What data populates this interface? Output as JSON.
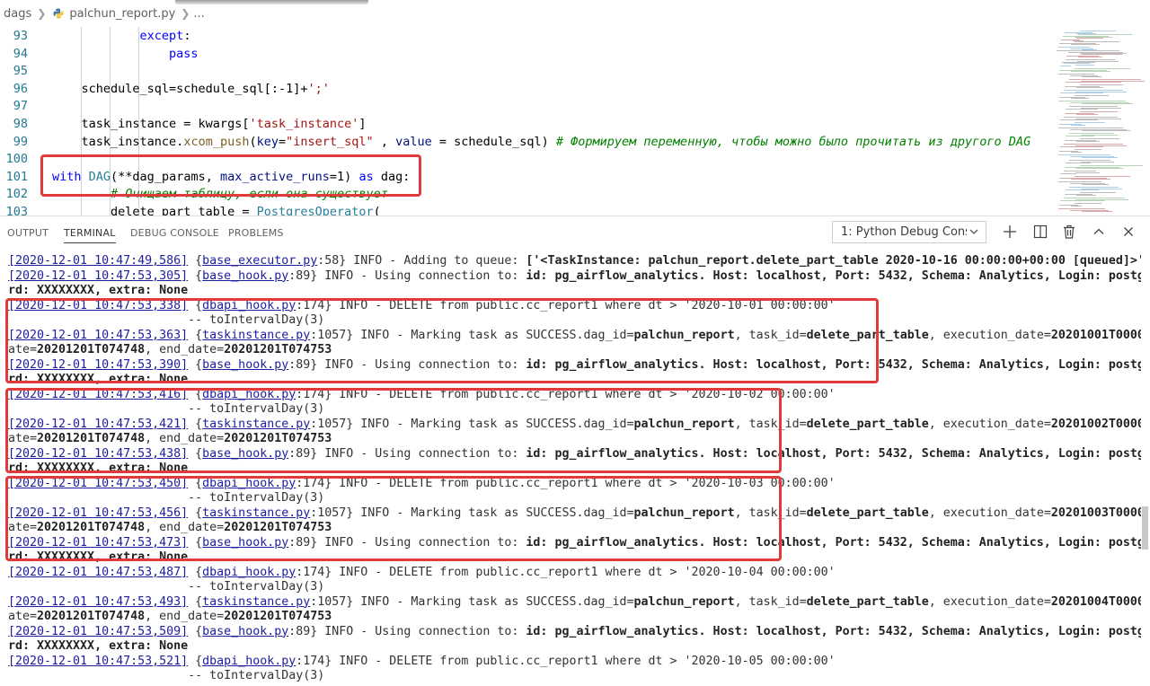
{
  "breadcrumb": {
    "folder": "dags",
    "file": "palchun_report.py",
    "more": "..."
  },
  "editor": {
    "lines": [
      {
        "n": "93",
        "tokens": [
          [
            "            ",
            "plain"
          ],
          [
            "except",
            "kw2"
          ],
          [
            ":",
            "plain"
          ]
        ]
      },
      {
        "n": "94",
        "tokens": [
          [
            "                ",
            "plain"
          ],
          [
            "pass",
            "kw2"
          ]
        ]
      },
      {
        "n": "95",
        "tokens": []
      },
      {
        "n": "96",
        "tokens": [
          [
            "    schedule_sql=schedule_sql[:-1]+",
            "plain"
          ],
          [
            "';'",
            "str"
          ]
        ]
      },
      {
        "n": "97",
        "tokens": []
      },
      {
        "n": "98",
        "tokens": [
          [
            "    task_instance = kwargs[",
            "plain"
          ],
          [
            "'task_instance'",
            "str"
          ],
          [
            "]",
            "plain"
          ]
        ]
      },
      {
        "n": "99",
        "tokens": [
          [
            "    task_instance.",
            "plain"
          ],
          [
            "xcom_push",
            "fn"
          ],
          [
            "(",
            "plain"
          ],
          [
            "key",
            "param"
          ],
          [
            "=",
            "plain"
          ],
          [
            "\"insert_sql\"",
            "str"
          ],
          [
            " , ",
            "plain"
          ],
          [
            "value",
            "param"
          ],
          [
            " = schedule_sql) ",
            "plain"
          ],
          [
            "# Формируем переменную, чтобы можно было прочитать из другого DAG",
            "cmt"
          ]
        ]
      },
      {
        "n": "100",
        "tokens": []
      },
      {
        "n": "101",
        "tokens": [
          [
            "with",
            "kw2"
          ],
          [
            " ",
            "plain"
          ],
          [
            "DAG",
            "cls"
          ],
          [
            "(**dag_params, ",
            "plain"
          ],
          [
            "max_active_runs",
            "param"
          ],
          [
            "=",
            "plain"
          ],
          [
            "1",
            "num"
          ],
          [
            ") ",
            "plain"
          ],
          [
            "as",
            "kw2"
          ],
          [
            " dag:",
            "plain"
          ]
        ]
      },
      {
        "n": "102",
        "tokens": [
          [
            "        ",
            "plain"
          ],
          [
            "# Очищаем таблицу, если она существует",
            "cmt"
          ]
        ]
      },
      {
        "n": "103",
        "tokens": [
          [
            "        delete_part_table = ",
            "plain"
          ],
          [
            "PostgresOperator",
            "cls"
          ],
          [
            "(",
            "plain"
          ]
        ]
      }
    ]
  },
  "panel": {
    "tabs": [
      "OUTPUT",
      "TERMINAL",
      "DEBUG CONSOLE",
      "PROBLEMS"
    ],
    "active_tab": "TERMINAL",
    "terminal_select": "1: Python Debug Consc",
    "colors": {
      "highlight_box": "#e03a3a",
      "link": "#1e1e9c"
    }
  },
  "terminal": {
    "lines": [
      [
        [
          "[2020-12-01 10:47:49,586]",
          "u"
        ],
        [
          " {",
          "p"
        ],
        [
          "base_executor.py",
          "u"
        ],
        [
          ":58} INFO - Adding to queue: ",
          "p"
        ],
        [
          "['<TaskInstance: palchun_report.delete_part_table 2020-10-16 00:00:00+00:00 [queued]>']",
          "b"
        ]
      ],
      [
        [
          "[2020-12-01 10:47:53,305]",
          "u"
        ],
        [
          " {",
          "p"
        ],
        [
          "base_hook.py",
          "u"
        ],
        [
          ":89} INFO - Using connection to: ",
          "p"
        ],
        [
          "id: pg_airflow_analytics. Host: localhost, Port: 5432, Schema: Analytics, Login: postgres, Passwo",
          "b"
        ]
      ],
      [
        [
          "rd: XXXXXXXX, extra: None",
          "b"
        ]
      ],
      [
        [
          "[2020-12-01 10:47:53,338]",
          "u"
        ],
        [
          " {",
          "p"
        ],
        [
          "dbapi_hook.py",
          "u"
        ],
        [
          ":174} INFO - DELETE from public.cc_report1 where dt > '2020-10-01 00:00:00'",
          "p"
        ]
      ],
      [
        [
          "                         -- toIntervalDay(3)",
          "p"
        ]
      ],
      [
        [
          "[2020-12-01 10:47:53,363]",
          "u"
        ],
        [
          " {",
          "p"
        ],
        [
          "taskinstance.py",
          "u"
        ],
        [
          ":1057} INFO - Marking task as SUCCESS.dag_id=",
          "p"
        ],
        [
          "palchun_report",
          "b"
        ],
        [
          ", task_id=",
          "p"
        ],
        [
          "delete_part_table",
          "b"
        ],
        [
          ", execution_date=",
          "p"
        ],
        [
          "20201001T000000",
          "b"
        ],
        [
          ", start_d",
          "p"
        ]
      ],
      [
        [
          "ate=",
          "p"
        ],
        [
          "20201201T074748",
          "b"
        ],
        [
          ", end_date=",
          "p"
        ],
        [
          "20201201T074753",
          "b"
        ]
      ],
      [
        [
          "[2020-12-01 10:47:53,390]",
          "u"
        ],
        [
          " {",
          "p"
        ],
        [
          "base_hook.py",
          "u"
        ],
        [
          ":89} INFO - Using connection to: ",
          "p"
        ],
        [
          "id: pg_airflow_analytics. Host: localhost, Port: 5432, Schema: Analytics, Login: postgres, Passwo",
          "b"
        ]
      ],
      [
        [
          "rd: XXXXXXXX, extra: None",
          "b"
        ]
      ],
      [
        [
          "[2020-12-01 10:47:53,416]",
          "u"
        ],
        [
          " {",
          "p"
        ],
        [
          "dbapi_hook.py",
          "u"
        ],
        [
          ":174} INFO - DELETE from public.cc_report1 where dt > '2020-10-02 00:00:00'",
          "p"
        ]
      ],
      [
        [
          "                         -- toIntervalDay(3)",
          "p"
        ]
      ],
      [
        [
          "[2020-12-01 10:47:53,421]",
          "u"
        ],
        [
          " {",
          "p"
        ],
        [
          "taskinstance.py",
          "u"
        ],
        [
          ":1057} INFO - Marking task as SUCCESS.dag_id=",
          "p"
        ],
        [
          "palchun_report",
          "b"
        ],
        [
          ", task_id=",
          "p"
        ],
        [
          "delete_part_table",
          "b"
        ],
        [
          ", execution_date=",
          "p"
        ],
        [
          "20201002T000000",
          "b"
        ],
        [
          ", start_d",
          "p"
        ]
      ],
      [
        [
          "ate=",
          "p"
        ],
        [
          "20201201T074748",
          "b"
        ],
        [
          ", end_date=",
          "p"
        ],
        [
          "20201201T074753",
          "b"
        ]
      ],
      [
        [
          "[2020-12-01 10:47:53,438]",
          "u"
        ],
        [
          " {",
          "p"
        ],
        [
          "base_hook.py",
          "u"
        ],
        [
          ":89} INFO - Using connection to: ",
          "p"
        ],
        [
          "id: pg_airflow_analytics. Host: localhost, Port: 5432, Schema: Analytics, Login: postgres, Passwo",
          "b"
        ]
      ],
      [
        [
          "rd: XXXXXXXX, extra: None",
          "b"
        ]
      ],
      [
        [
          "[2020-12-01 10:47:53,450]",
          "u"
        ],
        [
          " {",
          "p"
        ],
        [
          "dbapi_hook.py",
          "u"
        ],
        [
          ":174} INFO - DELETE from public.cc_report1 where dt > '2020-10-03 00:00:00'",
          "p"
        ]
      ],
      [
        [
          "                         -- toIntervalDay(3)",
          "p"
        ]
      ],
      [
        [
          "[2020-12-01 10:47:53,456]",
          "u"
        ],
        [
          " {",
          "p"
        ],
        [
          "taskinstance.py",
          "u"
        ],
        [
          ":1057} INFO - Marking task as SUCCESS.dag_id=",
          "p"
        ],
        [
          "palchun_report",
          "b"
        ],
        [
          ", task_id=",
          "p"
        ],
        [
          "delete_part_table",
          "b"
        ],
        [
          ", execution_date=",
          "p"
        ],
        [
          "20201003T000000",
          "b"
        ],
        [
          ", start_d",
          "p"
        ]
      ],
      [
        [
          "ate=",
          "p"
        ],
        [
          "20201201T074748",
          "b"
        ],
        [
          ", end_date=",
          "p"
        ],
        [
          "20201201T074753",
          "b"
        ]
      ],
      [
        [
          "[2020-12-01 10:47:53,473]",
          "u"
        ],
        [
          " {",
          "p"
        ],
        [
          "base_hook.py",
          "u"
        ],
        [
          ":89} INFO - Using connection to: ",
          "p"
        ],
        [
          "id: pg_airflow_analytics. Host: localhost, Port: 5432, Schema: Analytics, Login: postgres, Passwo",
          "b"
        ]
      ],
      [
        [
          "rd: XXXXXXXX, extra: None",
          "b"
        ]
      ],
      [
        [
          "[2020-12-01 10:47:53,487]",
          "u"
        ],
        [
          " {",
          "p"
        ],
        [
          "dbapi_hook.py",
          "u"
        ],
        [
          ":174} INFO - DELETE from public.cc_report1 where dt > '2020-10-04 00:00:00'",
          "p"
        ]
      ],
      [
        [
          "                         -- toIntervalDay(3)",
          "p"
        ]
      ],
      [
        [
          "[2020-12-01 10:47:53,493]",
          "u"
        ],
        [
          " {",
          "p"
        ],
        [
          "taskinstance.py",
          "u"
        ],
        [
          ":1057} INFO - Marking task as SUCCESS.dag_id=",
          "p"
        ],
        [
          "palchun_report",
          "b"
        ],
        [
          ", task_id=",
          "p"
        ],
        [
          "delete_part_table",
          "b"
        ],
        [
          ", execution_date=",
          "p"
        ],
        [
          "20201004T000000",
          "b"
        ],
        [
          ", start_d",
          "p"
        ]
      ],
      [
        [
          "ate=",
          "p"
        ],
        [
          "20201201T074748",
          "b"
        ],
        [
          ", end_date=",
          "p"
        ],
        [
          "20201201T074753",
          "b"
        ]
      ],
      [
        [
          "[2020-12-01 10:47:53,509]",
          "u"
        ],
        [
          " {",
          "p"
        ],
        [
          "base_hook.py",
          "u"
        ],
        [
          ":89} INFO - Using connection to: ",
          "p"
        ],
        [
          "id: pg_airflow_analytics. Host: localhost, Port: 5432, Schema: Analytics, Login: postgres, Passwo",
          "b"
        ]
      ],
      [
        [
          "rd: XXXXXXXX, extra: None",
          "b"
        ]
      ],
      [
        [
          "[2020-12-01 10:47:53,521]",
          "u"
        ],
        [
          " {",
          "p"
        ],
        [
          "dbapi_hook.py",
          "u"
        ],
        [
          ":174} INFO - DELETE from public.cc_report1 where dt > '2020-10-05 00:00:00'",
          "p"
        ]
      ],
      [
        [
          "                         -- toIntervalDay(3)",
          "p"
        ]
      ]
    ]
  }
}
